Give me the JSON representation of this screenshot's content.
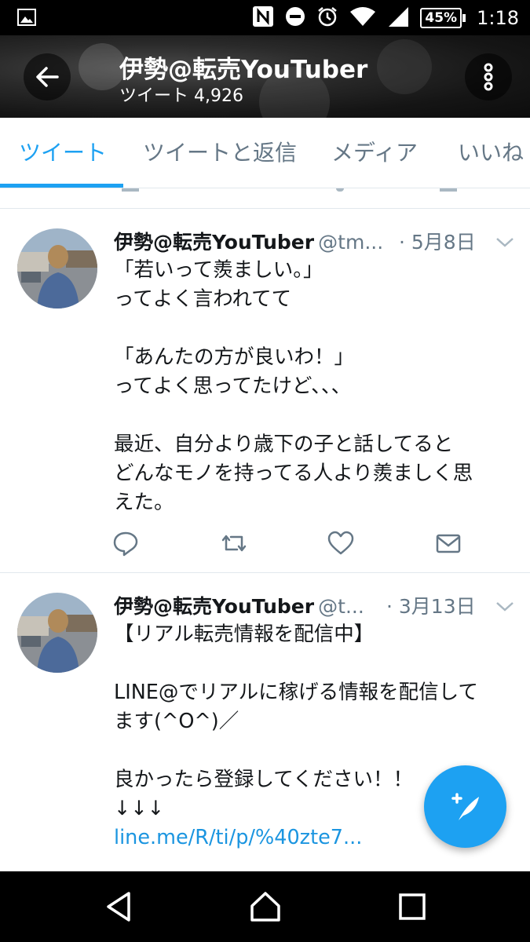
{
  "status_bar": {
    "battery": "45%",
    "time": "1:18",
    "icons": [
      "image-icon",
      "nfc-icon",
      "do-not-disturb-icon",
      "alarm-icon",
      "wifi-icon",
      "signal-icon",
      "battery-icon"
    ]
  },
  "header": {
    "title": "伊勢@転売YouTuber",
    "tweet_count": "ツイート 4,926"
  },
  "tabs": [
    {
      "label": "ツイート",
      "active": true
    },
    {
      "label": "ツイートと返信",
      "active": false
    },
    {
      "label": "メディア",
      "active": false
    },
    {
      "label": "いいね",
      "active": false
    }
  ],
  "tweets": [
    {
      "name": "伊勢@転売YouTuber",
      "handle": "@tm...",
      "date": "· 5月8日",
      "text": "「若いって羨ましい。」\nってよく言われてて\n\n「あんたの方が良いわ！」\nってよく思ってたけど、、、\n\n最近、自分より歳下の子と話してると\nどんなモノを持ってる人より羨ましく思\nえた。"
    },
    {
      "name": "伊勢@転売YouTuber",
      "handle": "@t...",
      "date": "· 3月13日",
      "text": "【リアル転売情報を配信中】\n\nLINE@でリアルに稼げる情報を配信して\nます(^O^)／\n\n良かったら登録してください！！\n↓↓↓",
      "link": "line.me/R/ti/p/%40zte7..."
    }
  ],
  "colors": {
    "accent": "#1da1f2",
    "link": "#1b95e0",
    "secondary_text": "#657786"
  }
}
